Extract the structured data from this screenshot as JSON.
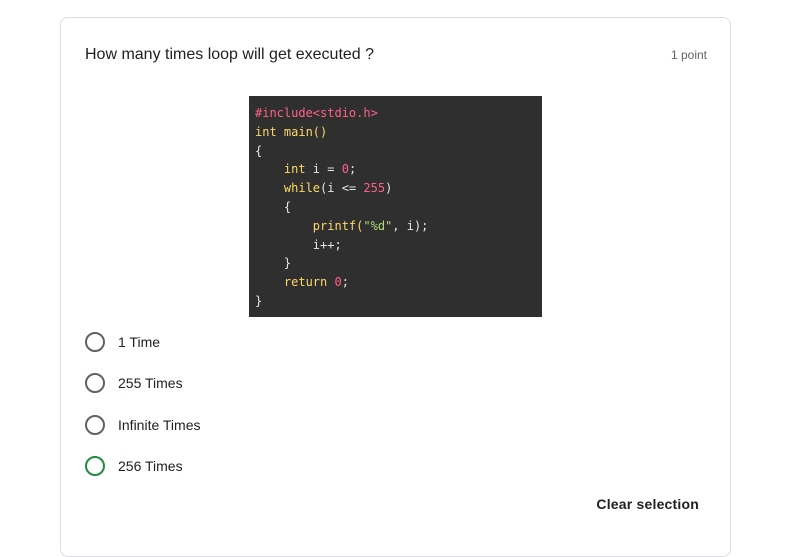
{
  "question": {
    "title": "How many times loop will get executed ?",
    "points": "1 point"
  },
  "code": {
    "lines": [
      [
        {
          "t": "#include<stdio.h>",
          "c": "inc"
        }
      ],
      [
        {
          "t": "int ",
          "c": "kw"
        },
        {
          "t": "main()",
          "c": "kw"
        }
      ],
      [
        {
          "t": "{",
          "c": "pl"
        }
      ],
      [
        {
          "t": "    int ",
          "c": "kw"
        },
        {
          "t": "i = ",
          "c": "pl"
        },
        {
          "t": "0",
          "c": "num"
        },
        {
          "t": ";",
          "c": "pl"
        }
      ],
      [
        {
          "t": "    while",
          "c": "kw"
        },
        {
          "t": "(i <= ",
          "c": "pl"
        },
        {
          "t": "255",
          "c": "num"
        },
        {
          "t": ")",
          "c": "pl"
        }
      ],
      [
        {
          "t": "    {",
          "c": "pl"
        }
      ],
      [
        {
          "t": "        printf(",
          "c": "kw"
        },
        {
          "t": "\"%d\"",
          "c": "str"
        },
        {
          "t": ", i);",
          "c": "pl"
        }
      ],
      [
        {
          "t": "        i++;",
          "c": "pl"
        }
      ],
      [
        {
          "t": "    }",
          "c": "pl"
        }
      ],
      [
        {
          "t": "    return ",
          "c": "kw"
        },
        {
          "t": "0",
          "c": "num"
        },
        {
          "t": ";",
          "c": "pl"
        }
      ],
      [
        {
          "t": "}",
          "c": "pl"
        }
      ]
    ]
  },
  "options": [
    {
      "label": "1 Time"
    },
    {
      "label": "255 Times"
    },
    {
      "label": "Infinite Times"
    },
    {
      "label": "256 Times"
    }
  ],
  "actions": {
    "clear_label": "Clear selection"
  },
  "colors": {
    "accent_radio": "#1e8e3e",
    "radio_border": "#5f6368"
  }
}
